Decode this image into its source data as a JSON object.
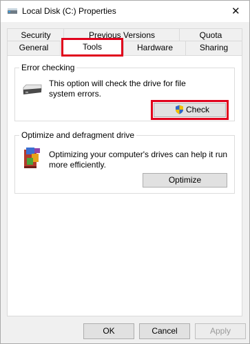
{
  "window": {
    "title": "Local Disk (C:) Properties",
    "close_glyph": "✕"
  },
  "tabs": {
    "row1": [
      {
        "label": "Security"
      },
      {
        "label": "Previous Versions"
      },
      {
        "label": "Quota"
      }
    ],
    "row2": [
      {
        "label": "General"
      },
      {
        "label": "Tools",
        "selected": true
      },
      {
        "label": "Hardware"
      },
      {
        "label": "Sharing"
      }
    ]
  },
  "error_checking": {
    "title": "Error checking",
    "description_line1": "This option will check the drive for file",
    "description_line2": "system errors.",
    "button_label": "Check",
    "icon": "drive-icon",
    "button_icon": "uac-shield-icon"
  },
  "optimize": {
    "title": "Optimize and defragment drive",
    "description_line1": "Optimizing your computer's drives can help it run",
    "description_line2": "more efficiently.",
    "button_label": "Optimize",
    "icon": "defrag-icon"
  },
  "buttons": {
    "ok": "OK",
    "cancel": "Cancel",
    "apply": "Apply"
  },
  "colors": {
    "highlight": "#e0001b",
    "window_bg": "#f0f0f0",
    "panel_bg": "#ffffff"
  }
}
